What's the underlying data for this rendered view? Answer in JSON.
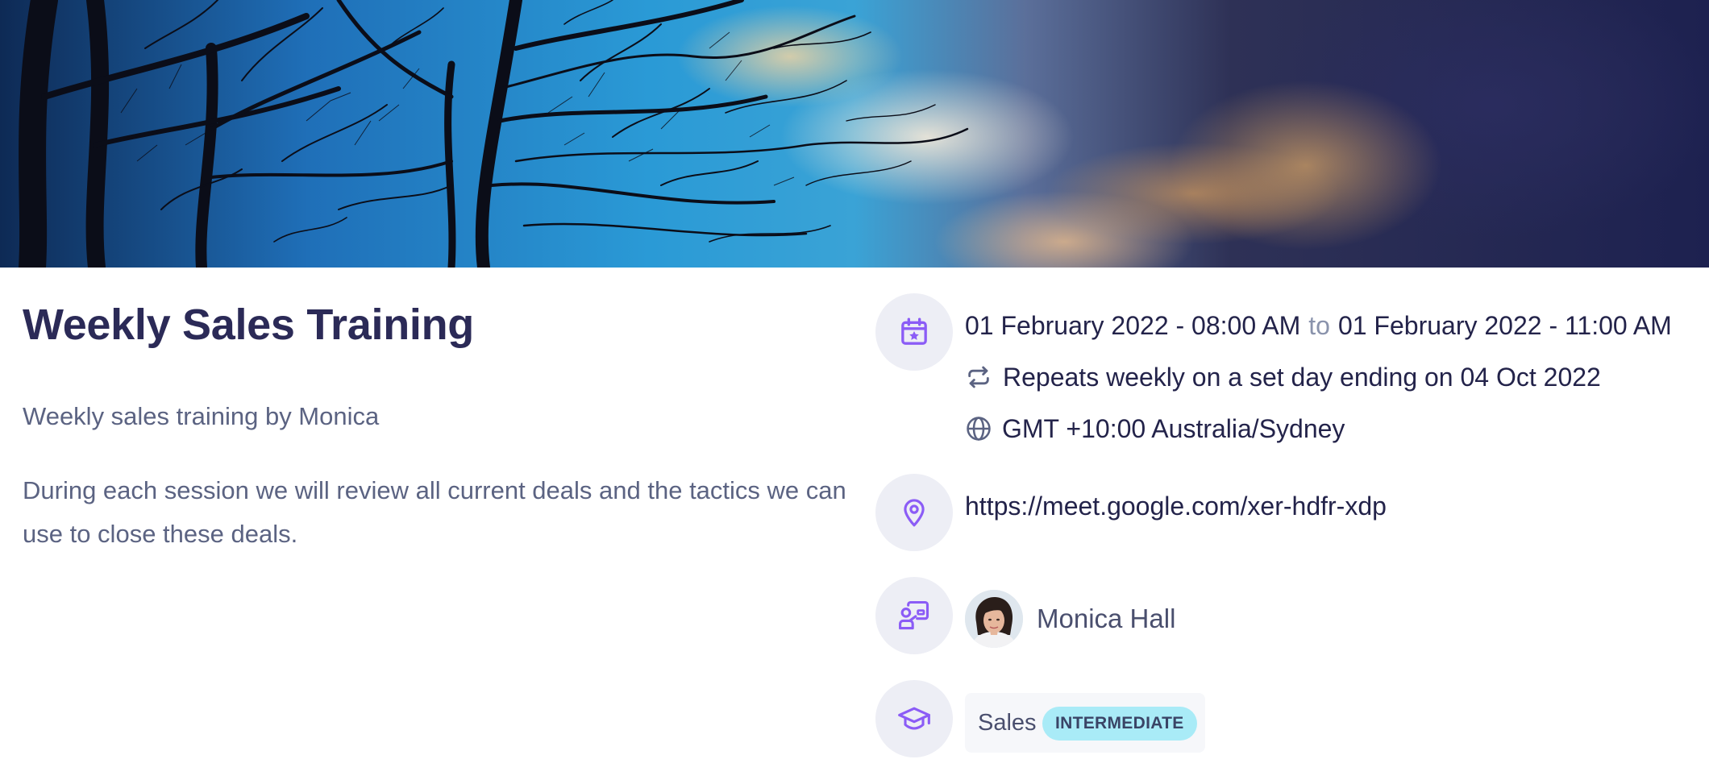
{
  "event": {
    "title": "Weekly Sales Training",
    "subtitle": "Weekly sales training by Monica",
    "description": "During each session we will review all current deals and the tactics we can use to close these deals."
  },
  "schedule": {
    "start": "01 February 2022 - 08:00 AM",
    "to_label": "to",
    "end": "01 February 2022 - 11:00 AM",
    "recurrence": "Repeats weekly on a set day ending on 04 Oct 2022",
    "timezone": "GMT +10:00 Australia/Sydney"
  },
  "location": {
    "url": "https://meet.google.com/xer-hdfr-xdp"
  },
  "host": {
    "name": "Monica Hall"
  },
  "category": {
    "name": "Sales",
    "level": "INTERMEDIATE"
  },
  "icons": {
    "schedule": "calendar-star-icon",
    "recurrence": "repeat-icon",
    "timezone": "globe-icon",
    "location": "map-pin-icon",
    "host": "presenter-icon",
    "category": "graduation-cap-icon"
  },
  "colors": {
    "accent": "#8b5cf6",
    "title": "#2b2a57",
    "badge_bg": "#a9ebf7"
  }
}
